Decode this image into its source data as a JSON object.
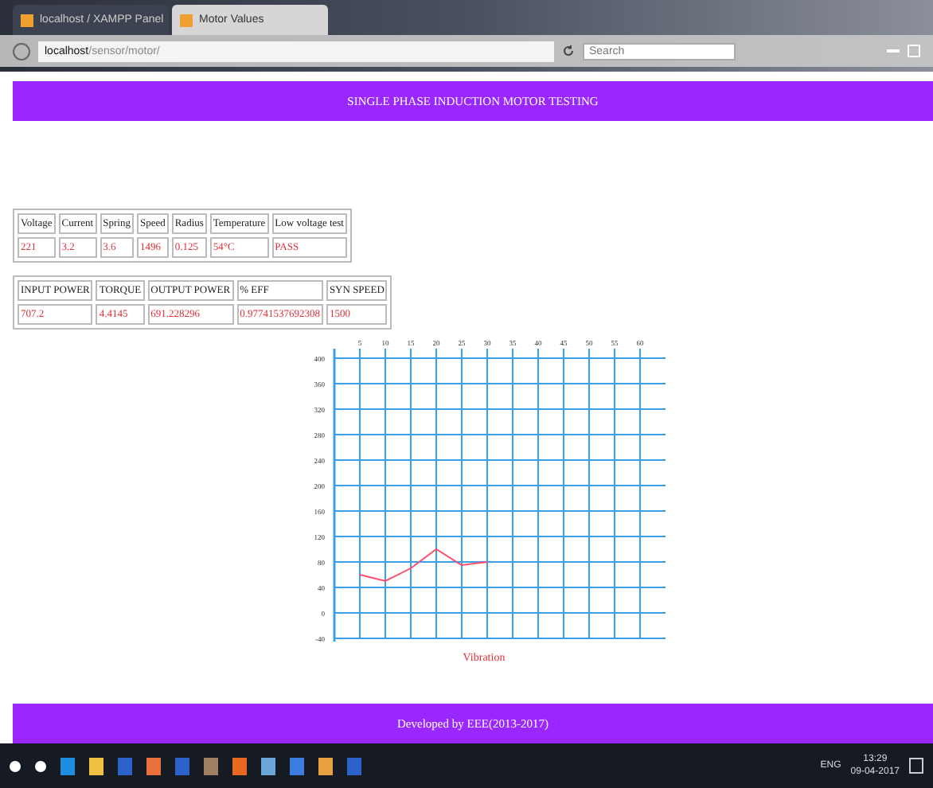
{
  "browser": {
    "tabs": [
      {
        "label": "localhost / XAMPP Panel",
        "selected": false
      },
      {
        "label": "Motor Values",
        "selected": true
      }
    ],
    "url_host": "localhost",
    "url_path": "/sensor/motor/",
    "search": {
      "placeholder": "Search"
    }
  },
  "header": {
    "title": "SINGLE PHASE INDUCTION MOTOR TESTING"
  },
  "table_1": {
    "columns": [
      "Voltage",
      "Current",
      "Spring",
      "Speed",
      "Radius",
      "Temperature",
      "Low voltage test"
    ],
    "rows": [
      [
        "221",
        "3.2",
        "3.6",
        "1496",
        "0.125",
        "54°C",
        "PASS"
      ]
    ]
  },
  "table_2": {
    "columns": [
      "INPUT POWER",
      "TORQUE",
      "OUTPUT POWER",
      "% EFF",
      "SYN SPEED"
    ],
    "rows": [
      [
        "707.2",
        "4.4145",
        "691.228296",
        "0.97741537692308",
        "1500"
      ]
    ]
  },
  "chart": {
    "chart_data": {
      "type": "line",
      "xlabel": "Vibration",
      "x": [
        5,
        10,
        15,
        20,
        25,
        30
      ],
      "series": [
        {
          "color": "#ff4d6a",
          "values": [
            60,
            50,
            70,
            100,
            75,
            80
          ]
        }
      ],
      "grid": true,
      "xlim": [
        0,
        65
      ],
      "ylim": [
        -40,
        400
      ],
      "xticks": [
        5,
        10,
        15,
        20,
        25,
        30,
        35,
        40,
        45,
        50,
        55,
        60
      ],
      "yticks": [
        -40,
        0,
        40,
        80,
        120,
        160,
        200,
        240,
        280,
        320,
        360,
        400
      ]
    }
  },
  "footer": {
    "text": "Developed by EEE(2013-2017)"
  },
  "taskbar": {
    "language": "ENG",
    "time": "13:29",
    "date": "09-04-2017"
  }
}
